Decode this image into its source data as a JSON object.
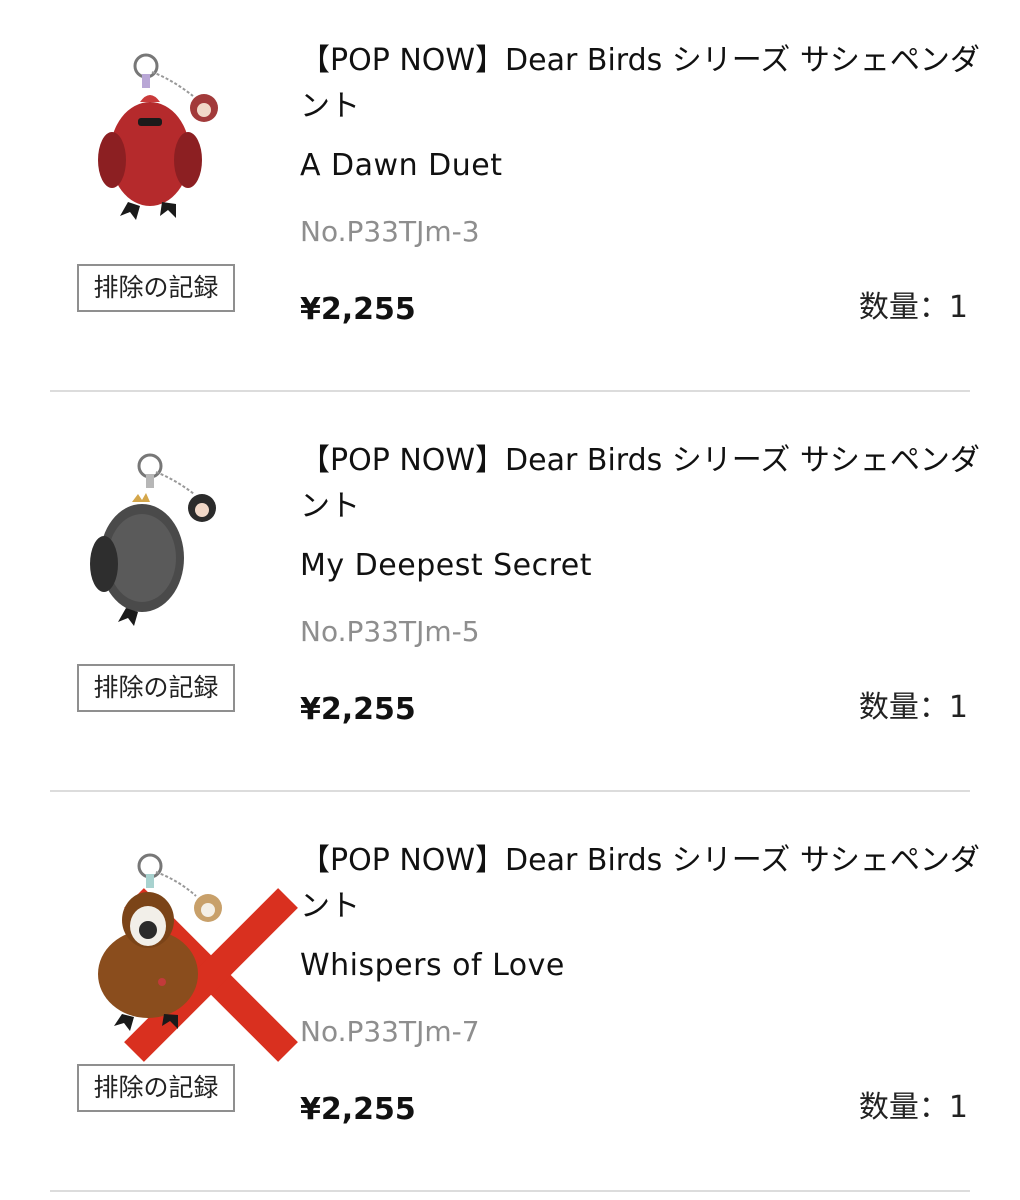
{
  "items": [
    {
      "title": "【POP NOW】Dear Birds シリーズ サシェペンダント",
      "variant": "A Dawn Duet",
      "sku": "No.P33TJm-3",
      "price": "¥2,255",
      "quantity": "数量：1",
      "remove_label": "排除の記録",
      "body_color": "#b52a2c",
      "excluded": false
    },
    {
      "title": "【POP NOW】Dear Birds シリーズ サシェペンダント",
      "variant": "My Deepest Secret",
      "sku": "No.P33TJm-5",
      "price": "¥2,255",
      "quantity": "数量：1",
      "remove_label": "排除の記録",
      "body_color": "#4a4a4a",
      "excluded": true
    },
    {
      "title": "【POP NOW】Dear Birds シリーズ サシェペンダント",
      "variant": "Whispers of Love",
      "sku": "No.P33TJm-7",
      "price": "¥2,255",
      "quantity": "数量：1",
      "remove_label": "排除の記録",
      "body_color": "#8a4d1d",
      "excluded": false
    }
  ],
  "colors": {
    "strike_red": "#d9301f",
    "divider": "#dcdcdc",
    "sku_gray": "#8e8e8e"
  },
  "icons": {
    "strike": "x-mark-icon"
  }
}
